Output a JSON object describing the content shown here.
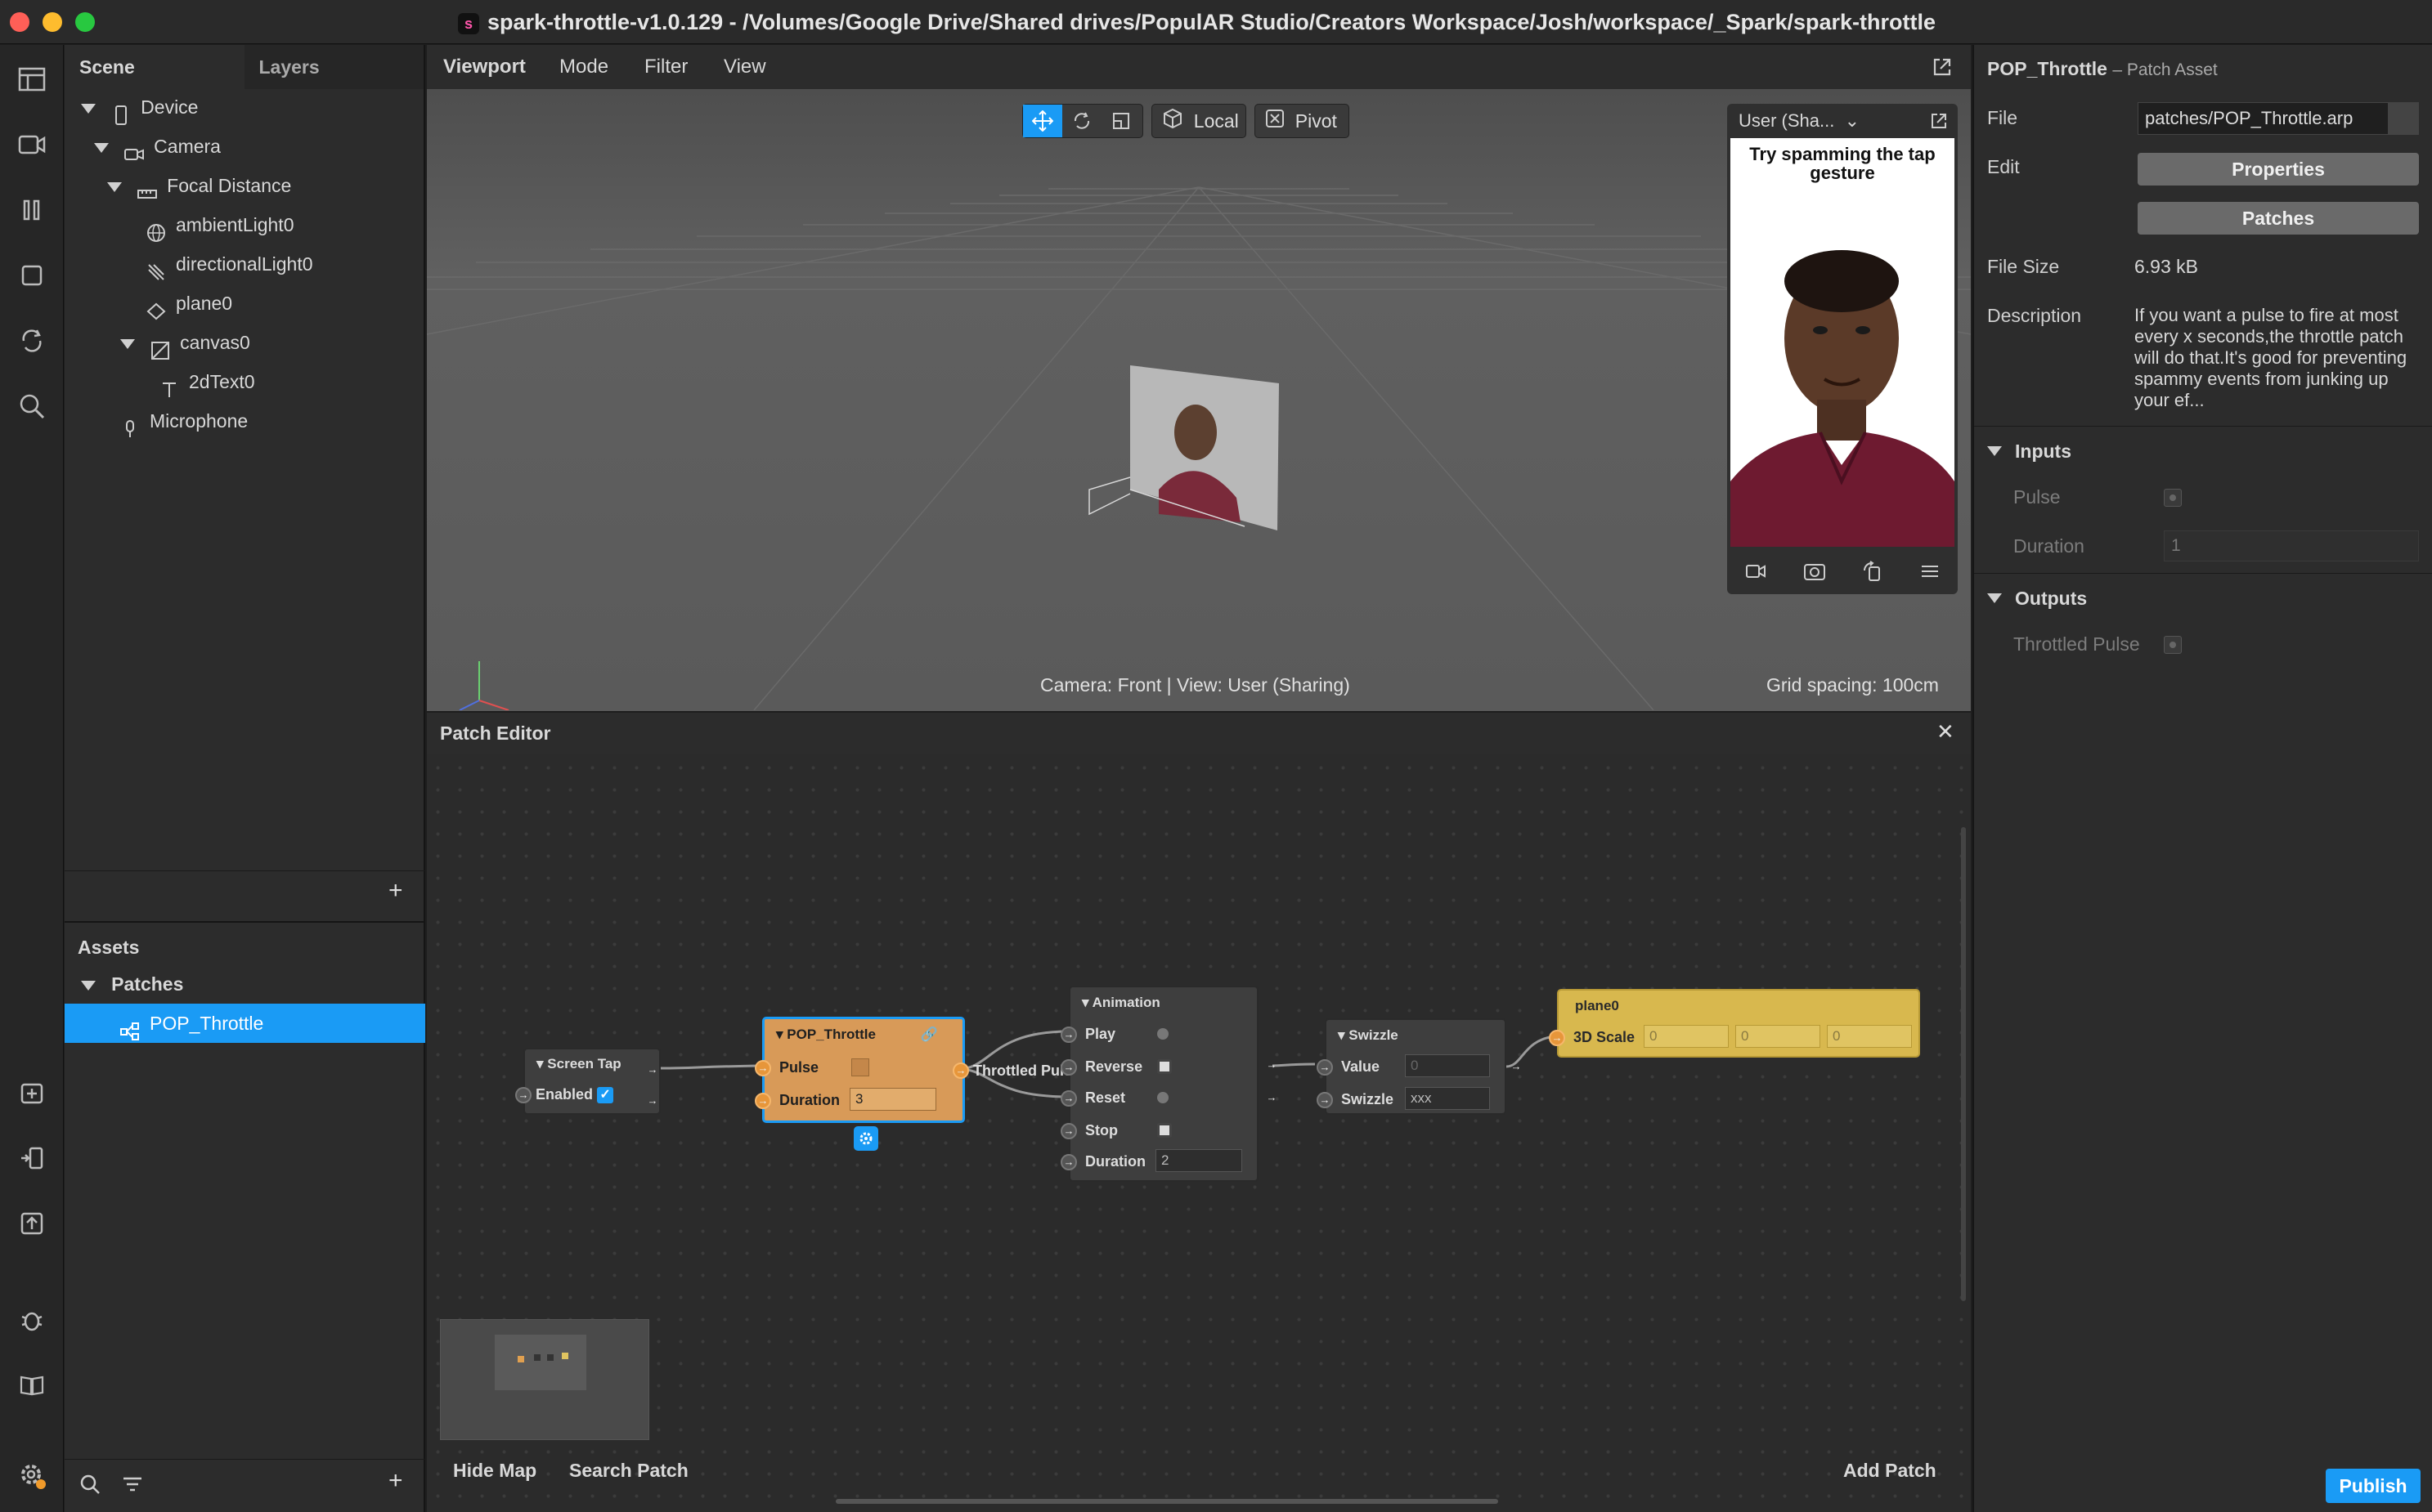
{
  "window": {
    "title": "spark-throttle-v1.0.129 - /Volumes/Google Drive/Shared drives/PopulAR Studio/Creators Workspace/Josh/workspace/_Spark/spark-throttle"
  },
  "scene_panel": {
    "tabs": [
      "Scene",
      "Layers"
    ],
    "tree": [
      {
        "label": "Device"
      },
      {
        "label": "Camera"
      },
      {
        "label": "Focal Distance"
      },
      {
        "label": "ambientLight0"
      },
      {
        "label": "directionalLight0"
      },
      {
        "label": "plane0"
      },
      {
        "label": "canvas0"
      },
      {
        "label": "2dText0"
      },
      {
        "label": "Microphone"
      }
    ]
  },
  "assets": {
    "title": "Assets",
    "group": "Patches",
    "selected_item": "POP_Throttle"
  },
  "viewport": {
    "menu": [
      "Viewport",
      "Mode",
      "Filter",
      "View"
    ],
    "toolbar": {
      "local": "Local",
      "pivot": "Pivot"
    },
    "preview": {
      "device": "User (Sha...",
      "caption": "Try spamming the tap gesture"
    },
    "status_left": "Camera: Front | View: User (Sharing)",
    "status_right": "Grid spacing: 100cm"
  },
  "patch_editor": {
    "title": "Patch Editor",
    "nodes": {
      "screen_tap": {
        "title": "Screen Tap",
        "enabled_label": "Enabled"
      },
      "throttle": {
        "title": "POP_Throttle",
        "pulse_label": "Pulse",
        "duration_label": "Duration",
        "duration_value": "3",
        "output_label": "Throttled Pulse"
      },
      "animation": {
        "title": "Animation",
        "play": "Play",
        "reverse": "Reverse",
        "reset": "Reset",
        "stop": "Stop",
        "duration_label": "Duration",
        "duration_value": "2"
      },
      "swizzle": {
        "title": "Swizzle",
        "value_label": "Value",
        "value": "0",
        "swizzle_label": "Swizzle",
        "swizzle_value": "xxx"
      },
      "plane": {
        "title": "plane0",
        "scale_label": "3D Scale",
        "x": "0",
        "y": "0",
        "z": "0"
      }
    },
    "footer": {
      "hide_map": "Hide Map",
      "search_patch": "Search Patch",
      "add_patch": "Add Patch"
    }
  },
  "properties": {
    "title": "POP_Throttle",
    "subtitle": "– Patch Asset",
    "file_label": "File",
    "file_value": "patches/POP_Throttle.arp",
    "edit_label": "Edit",
    "properties_button": "Properties",
    "patches_button": "Patches",
    "file_size_label": "File Size",
    "file_size_value": "6.93 kB",
    "description_label": "Description",
    "description_value": "If you want a pulse to fire at most every x seconds,the throttle patch will do that.It's good for preventing spammy events from junking up your ef...",
    "inputs_title": "Inputs",
    "pulse_label": "Pulse",
    "duration_label": "Duration",
    "duration_value": "1",
    "outputs_title": "Outputs",
    "throttled_label": "Throttled Pulse",
    "publish": "Publish"
  },
  "colors": {
    "accent": "#1a9bf5",
    "throttle_node": "#d89a58",
    "plane_node": "#d8b84e"
  }
}
